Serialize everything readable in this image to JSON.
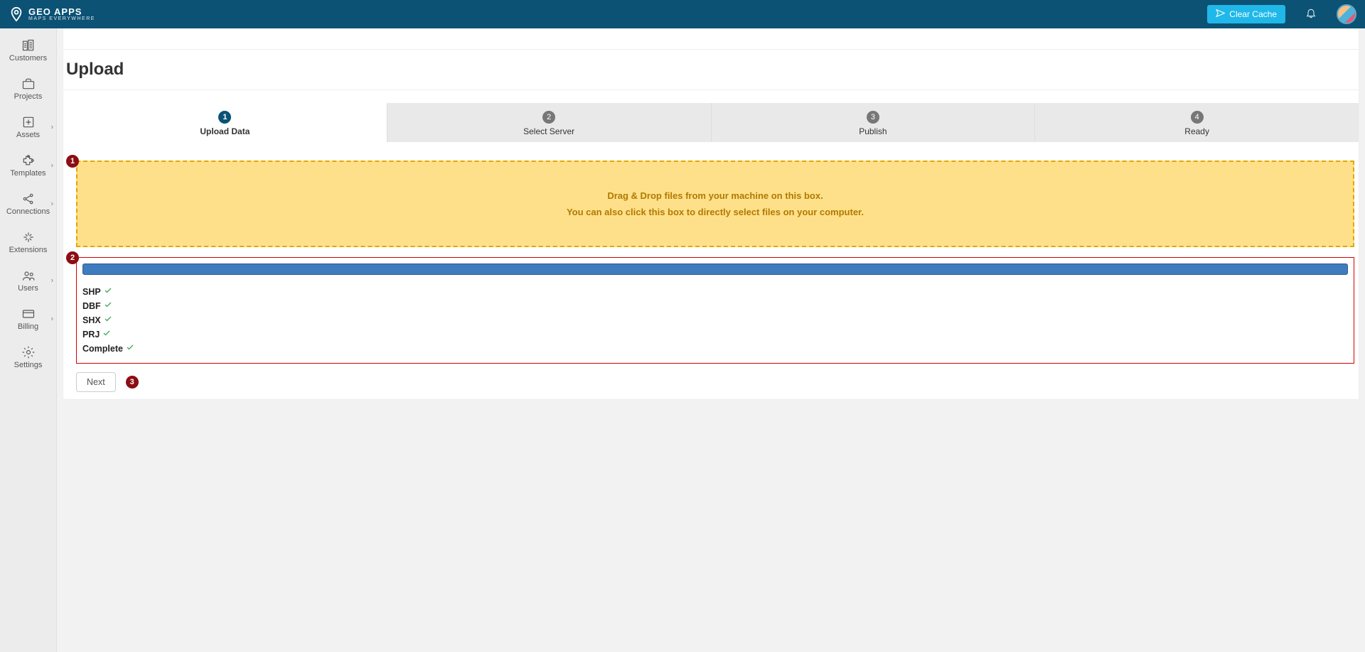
{
  "brand": {
    "line1": "GEO APPS",
    "line2": "MAPS EVERYWHERE"
  },
  "topbar": {
    "clear_cache": "Clear Cache"
  },
  "sidebar": {
    "items": [
      {
        "label": "Customers",
        "chevron": false
      },
      {
        "label": "Projects",
        "chevron": false
      },
      {
        "label": "Assets",
        "chevron": true
      },
      {
        "label": "Templates",
        "chevron": true
      },
      {
        "label": "Connections",
        "chevron": true
      },
      {
        "label": "Extensions",
        "chevron": false
      },
      {
        "label": "Users",
        "chevron": true
      },
      {
        "label": "Billing",
        "chevron": true
      },
      {
        "label": "Settings",
        "chevron": false
      }
    ]
  },
  "page": {
    "title": "Upload"
  },
  "stepper": {
    "steps": [
      {
        "num": "1",
        "label": "Upload Data",
        "active": true
      },
      {
        "num": "2",
        "label": "Select Server",
        "active": false
      },
      {
        "num": "3",
        "label": "Publish",
        "active": false
      },
      {
        "num": "4",
        "label": "Ready",
        "active": false
      }
    ]
  },
  "dropzone": {
    "line1": "Drag & Drop files from your machine on this box.",
    "line2": "You can also click this box to directly select files on your computer."
  },
  "upload_status": {
    "items": [
      {
        "name": "SHP",
        "ok": true
      },
      {
        "name": "DBF",
        "ok": true
      },
      {
        "name": "SHX",
        "ok": true
      },
      {
        "name": "PRJ",
        "ok": true
      },
      {
        "name": "Complete",
        "ok": true
      }
    ]
  },
  "callouts": {
    "drop": "1",
    "progress": "2",
    "next": "3"
  },
  "buttons": {
    "next": "Next"
  }
}
